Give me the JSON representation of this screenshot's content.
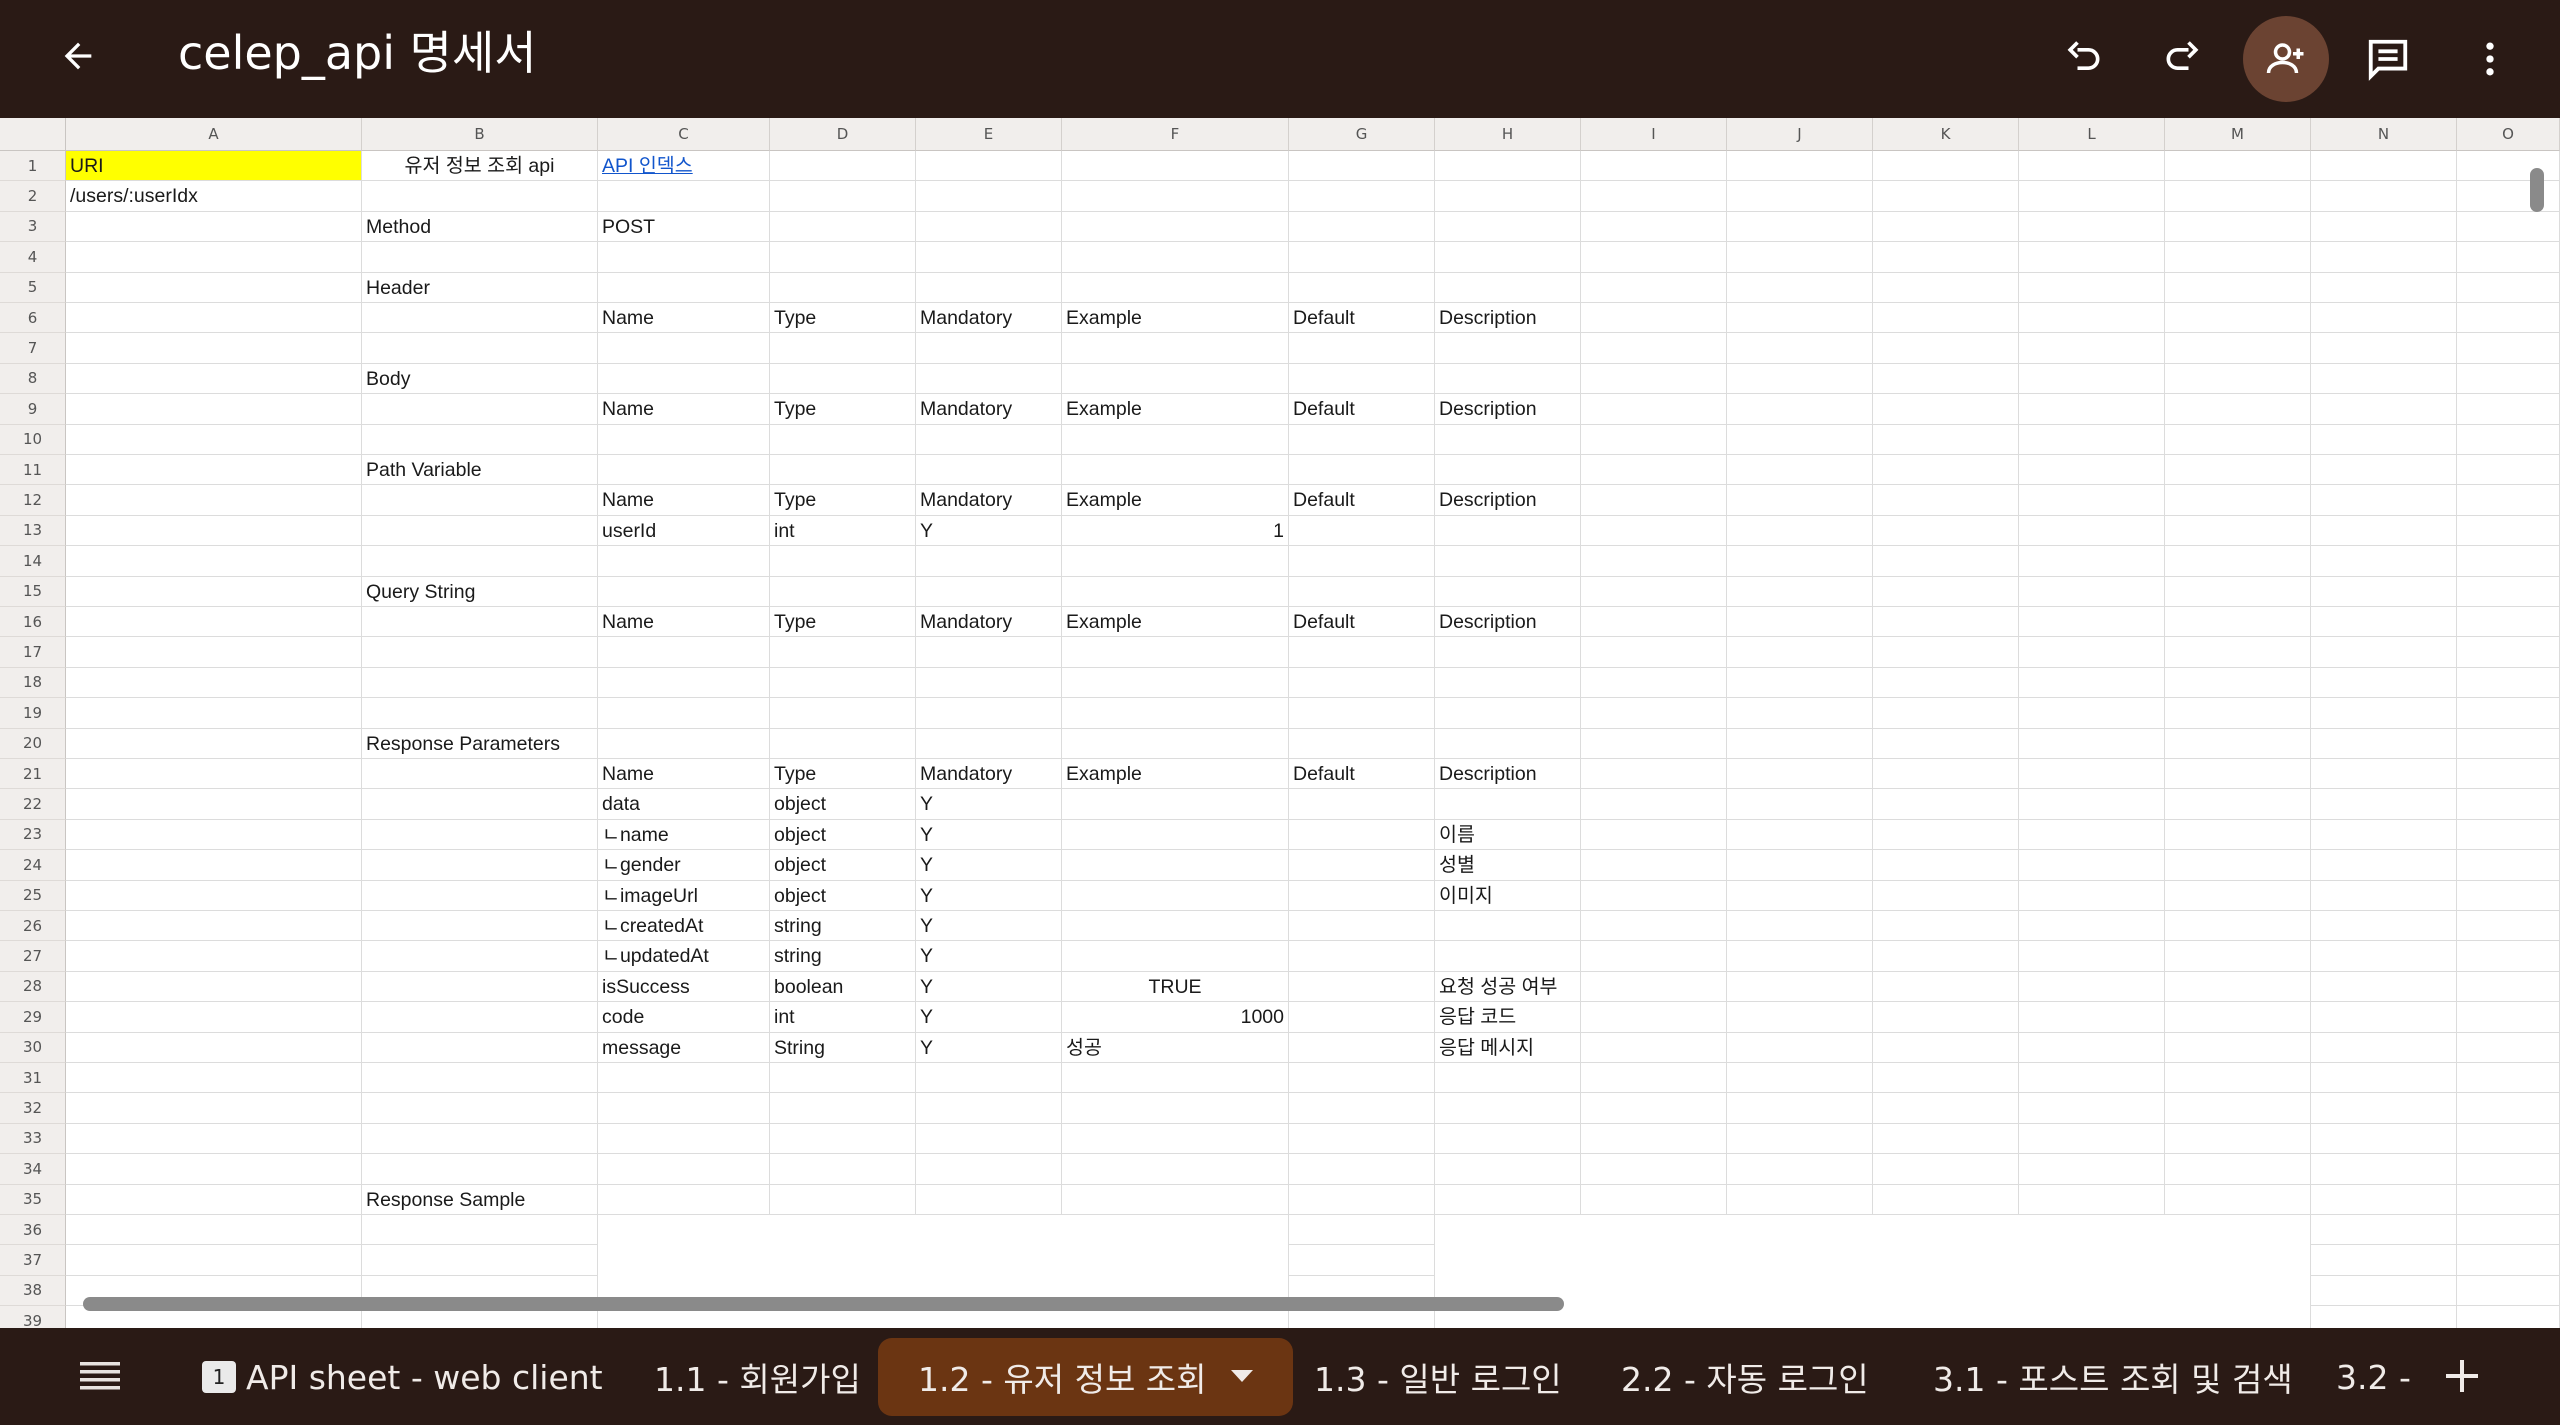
{
  "app": {
    "title": "celep_api 명세서",
    "icons": [
      "back-arrow-icon",
      "undo-icon",
      "redo-icon",
      "add-person-icon",
      "comment-icon",
      "more-vert-icon"
    ]
  },
  "columns": [
    "A",
    "B",
    "C",
    "D",
    "E",
    "F",
    "G",
    "H",
    "I",
    "J",
    "K",
    "L",
    "M",
    "N",
    "O"
  ],
  "rows": [
    "1",
    "2",
    "3",
    "4",
    "5",
    "6",
    "7",
    "8",
    "9",
    "10",
    "11",
    "12",
    "13",
    "14",
    "15",
    "16",
    "17",
    "18",
    "19",
    "20",
    "21",
    "22",
    "23",
    "24",
    "25",
    "26",
    "27",
    "28",
    "29",
    "30",
    "31",
    "32",
    "33",
    "34",
    "35",
    "36",
    "37",
    "38",
    "39"
  ],
  "cells": {
    "r1": {
      "A": "URI",
      "B": "유저 정보 조회 api",
      "C": "API 인덱스"
    },
    "r2": {
      "A": "/users/:userIdx"
    },
    "r3": {
      "B": "Method",
      "C": "POST"
    },
    "r5": {
      "B": "Header"
    },
    "r6": {
      "C": "Name",
      "D": "Type",
      "E": "Mandatory",
      "F": "Example",
      "G": "Default",
      "H": "Description"
    },
    "r8": {
      "B": "Body"
    },
    "r9": {
      "C": "Name",
      "D": "Type",
      "E": "Mandatory",
      "F": "Example",
      "G": "Default",
      "H": "Description"
    },
    "r11": {
      "B": "Path Variable"
    },
    "r12": {
      "C": "Name",
      "D": "Type",
      "E": "Mandatory",
      "F": "Example",
      "G": "Default",
      "H": "Description"
    },
    "r13": {
      "C": "userId",
      "D": "int",
      "E": "Y",
      "F": "1"
    },
    "r15": {
      "B": "Query String"
    },
    "r16": {
      "C": "Name",
      "D": "Type",
      "E": "Mandatory",
      "F": "Example",
      "G": "Default",
      "H": "Description"
    },
    "r20": {
      "B": "Response Parameters"
    },
    "r21": {
      "C": "Name",
      "D": "Type",
      "E": "Mandatory",
      "F": "Example",
      "G": "Default",
      "H": "Description"
    },
    "r22": {
      "C": "data",
      "D": "object",
      "E": "Y"
    },
    "r23": {
      "C": "ㄴname",
      "D": "object",
      "E": "Y",
      "H": "이름"
    },
    "r24": {
      "C": "ㄴgender",
      "D": "object",
      "E": "Y",
      "H": "성별"
    },
    "r25": {
      "C": "ㄴimageUrl",
      "D": "object",
      "E": "Y",
      "H": "이미지"
    },
    "r26": {
      "C": "ㄴcreatedAt",
      "D": "string",
      "E": "Y"
    },
    "r27": {
      "C": "ㄴupdatedAt",
      "D": "string",
      "E": "Y"
    },
    "r28": {
      "C": "isSuccess",
      "D": "boolean",
      "E": "Y",
      "F": "TRUE",
      "H": "요청 성공 여부"
    },
    "r29": {
      "C": "code",
      "D": "int",
      "E": "Y",
      "F": "1000",
      "H": "응답 코드"
    },
    "r30": {
      "C": "message",
      "D": "String",
      "E": "Y",
      "F": "성공",
      "H": "응답 메시지"
    },
    "r35": {
      "B": "Response Sample"
    }
  },
  "colors": {
    "header_bg": "#2a1a15",
    "active_tab": "#6b3512",
    "highlight": "#ffff00",
    "link": "#1155cc"
  },
  "sheets": {
    "menu_icon": "list-icon",
    "tabs": [
      {
        "label": "API sheet - web client",
        "badge": "1"
      },
      {
        "label": "1.1 - 회원가입"
      },
      {
        "label": "1.2 - 유저 정보 조회",
        "active": true
      },
      {
        "label": "1.3 - 일반 로그인"
      },
      {
        "label": "2.2 - 자동 로그인"
      },
      {
        "label": "3.1 - 포스트 조회 및 검색"
      },
      {
        "label": "3.2 -"
      }
    ]
  }
}
